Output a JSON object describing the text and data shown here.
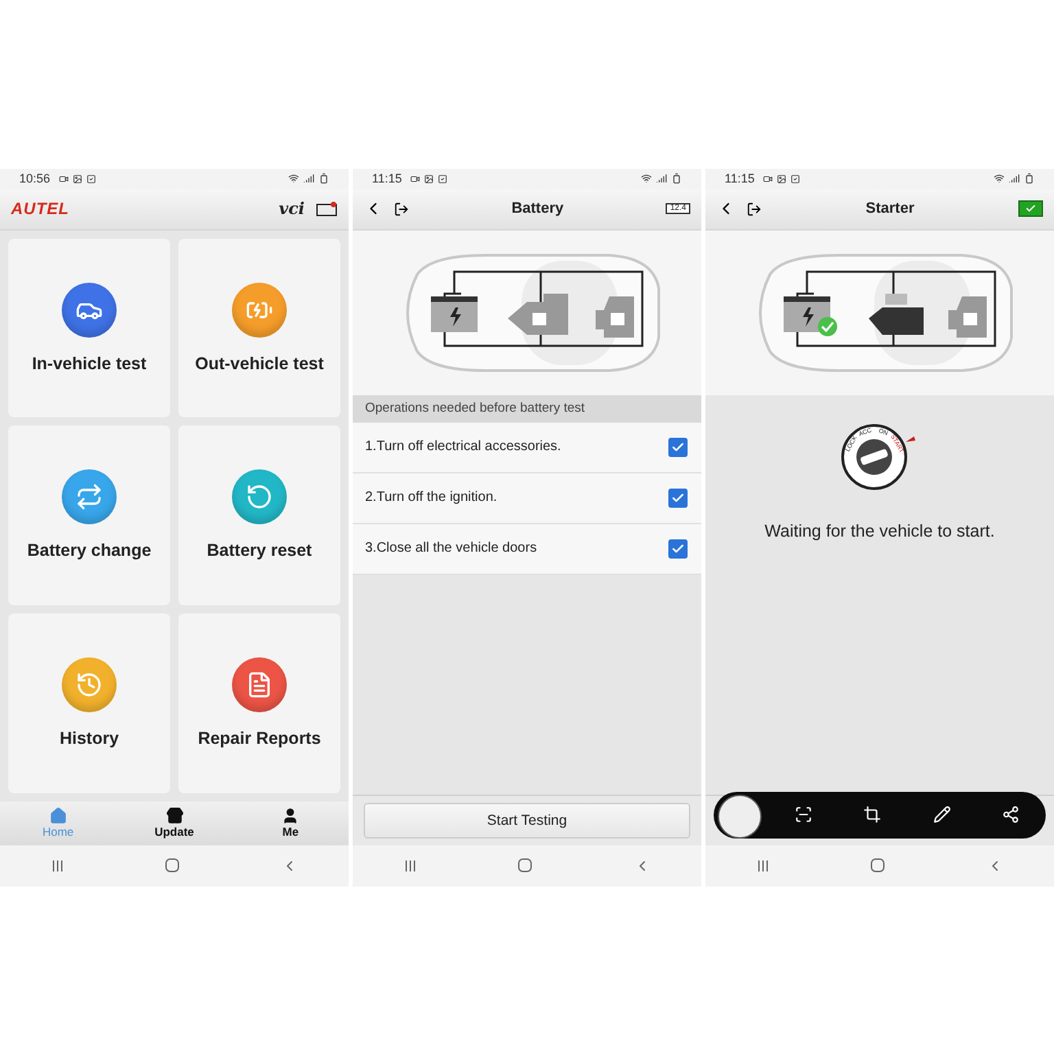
{
  "screens": [
    {
      "kind": "home",
      "status_time": "10:56",
      "brand": "AUTEL",
      "vci_label": "vci",
      "tiles": [
        {
          "label": "In-vehicle test",
          "color": "#3f72e6"
        },
        {
          "label": "Out-vehicle test",
          "color": "#f59d2a"
        },
        {
          "label": "Battery change",
          "color": "#38a6ea"
        },
        {
          "label": "Battery reset",
          "color": "#22b7c6"
        },
        {
          "label": "History",
          "color": "#f2b12c"
        },
        {
          "label": "Repair Reports",
          "color": "#ec5446"
        }
      ],
      "tabs": [
        {
          "label": "Home",
          "selected": true
        },
        {
          "label": "Update",
          "selected": false
        },
        {
          "label": "Me",
          "selected": false
        }
      ]
    },
    {
      "kind": "checklist",
      "status_time": "11:15",
      "title": "Battery",
      "battery_reading": "12.4",
      "section_header": "Operations needed before battery test",
      "items": [
        {
          "label": "1.Turn off electrical accessories.",
          "checked": true
        },
        {
          "label": "2.Turn off the ignition.",
          "checked": true
        },
        {
          "label": "3.Close all the vehicle doors",
          "checked": true
        }
      ],
      "button": "Start Testing"
    },
    {
      "kind": "waiting",
      "status_time": "11:15",
      "title": "Starter",
      "dial_labels": [
        "LOCK",
        "ACC",
        "ON",
        "START"
      ],
      "message": "Waiting for the vehicle to start."
    }
  ]
}
